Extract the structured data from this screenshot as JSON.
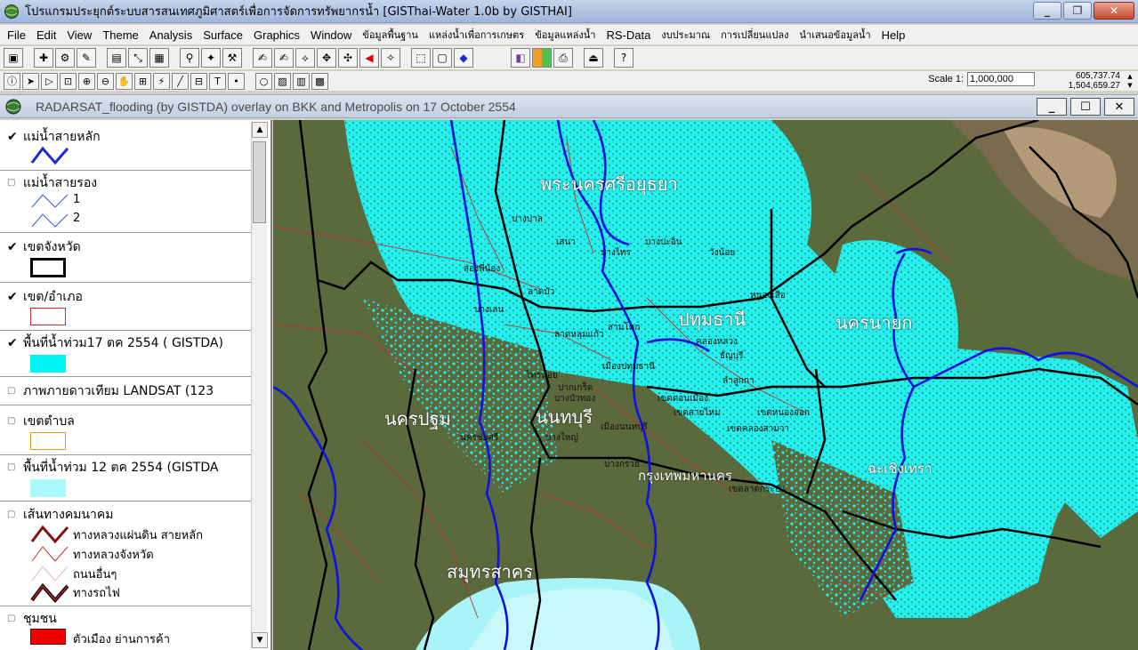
{
  "window": {
    "title": "โปรแกรมประยุกต์ระบบสารสนเทศภูมิศาสตร์เพื่อการจัดการทรัพยากรน้ำ  [GISThai-Water 1.0b   by GISTHAI]",
    "minimize": "_",
    "maximize": "❐",
    "close": "✕"
  },
  "menu": [
    {
      "label": "File"
    },
    {
      "label": "Edit"
    },
    {
      "label": "View"
    },
    {
      "label": "Theme"
    },
    {
      "label": "Analysis"
    },
    {
      "label": "Surface"
    },
    {
      "label": "Graphics"
    },
    {
      "label": "Window"
    },
    {
      "label": "ข้อมูลพื้นฐาน"
    },
    {
      "label": "แหล่งน้ำเพื่อการเกษตร"
    },
    {
      "label": "ข้อมูลแหล่งน้ำ"
    },
    {
      "label": "RS-Data"
    },
    {
      "label": "งบประมาณ"
    },
    {
      "label": "การเปลี่ยนแปลง"
    },
    {
      "label": "นำเสนอข้อมูลน้ำ"
    },
    {
      "label": "Help"
    }
  ],
  "scale": {
    "label": "Scale 1:",
    "value": "1,000,000"
  },
  "coords": {
    "x": "605,737.74",
    "y": "1,504,659.27"
  },
  "child_window": {
    "title": "RADARSAT_flooding (by GISTDA) overlay on BKK and Metropolis on 17 October 2554",
    "minimize": "_",
    "maximize": "☐",
    "close": "✕"
  },
  "legend": {
    "items": [
      {
        "label": "แม่น้ำสายหลัก",
        "checked": true
      },
      {
        "label": "แม่น้ำสายรอง",
        "checked": false,
        "sub": [
          "1",
          "2"
        ]
      },
      {
        "label": "เขตจังหวัด",
        "checked": true
      },
      {
        "label": "เขต/อำเภอ",
        "checked": true
      },
      {
        "label": "พื้นที่น้ำท่วม17 ตค 2554 ( GISTDA)",
        "checked": true
      },
      {
        "label": "ภาพภายดาวเทียม LANDSAT  (123",
        "checked": false
      },
      {
        "label": "เขตตำบล",
        "checked": false
      },
      {
        "label": "พื้นที่น้ำท่วม 12 ตค 2554  (GISTDA",
        "checked": false
      },
      {
        "label": "เส้นทางคมนาคม",
        "checked": false,
        "sub": [
          "ทางหลวงแผ่นดิน สายหลัก",
          "ทางหลวงจังหวัด",
          "ถนนอื่นๆ",
          "ทางรถไฟ"
        ]
      },
      {
        "label": "ชุมชน",
        "checked": false,
        "sub": [
          "ตัวเมือง ย่านการค้า"
        ]
      }
    ]
  },
  "map": {
    "labels_big": [
      "พระนครศรีอยุธยา",
      "ปทุมธานี",
      "นครนายก",
      "นครปฐม",
      "นนทบุรี",
      "กรุงเทพมหานคร",
      "ฉะเชิงเทรา",
      "สมุทรสาคร"
    ],
    "labels_small": [
      "บางบาล",
      "เสนา",
      "บางไทร",
      "บางปะอิน",
      "วังน้อย",
      "หนองเสือ",
      "คลองหลวง",
      "ธัญบุรี",
      "ลำลูกกา",
      "บางเลน",
      "ลาดบัว",
      "ลาดหลุมแก้ว",
      "สามโคก",
      "เมืองปทุมธานี",
      "ไทรน้อย",
      "บางบัวทอง",
      "บางใหญ่",
      "นครชัยศรี",
      "สองพี่น้อง",
      "เขตสายไหม",
      "เขตคลองสามวา",
      "เขตหนองจอก",
      "เขตลาดกระบัง",
      "เขตดอนเมือง",
      "ปากเกร็ด",
      "เมืองนนทบุรี",
      "บางกรวย"
    ],
    "colors": {
      "land": "#5b6a3c",
      "flood": "#22f0f0",
      "river": "#1010e0",
      "border": "#000000",
      "district": "#c0302a",
      "sea": "#a8f4f8"
    }
  }
}
